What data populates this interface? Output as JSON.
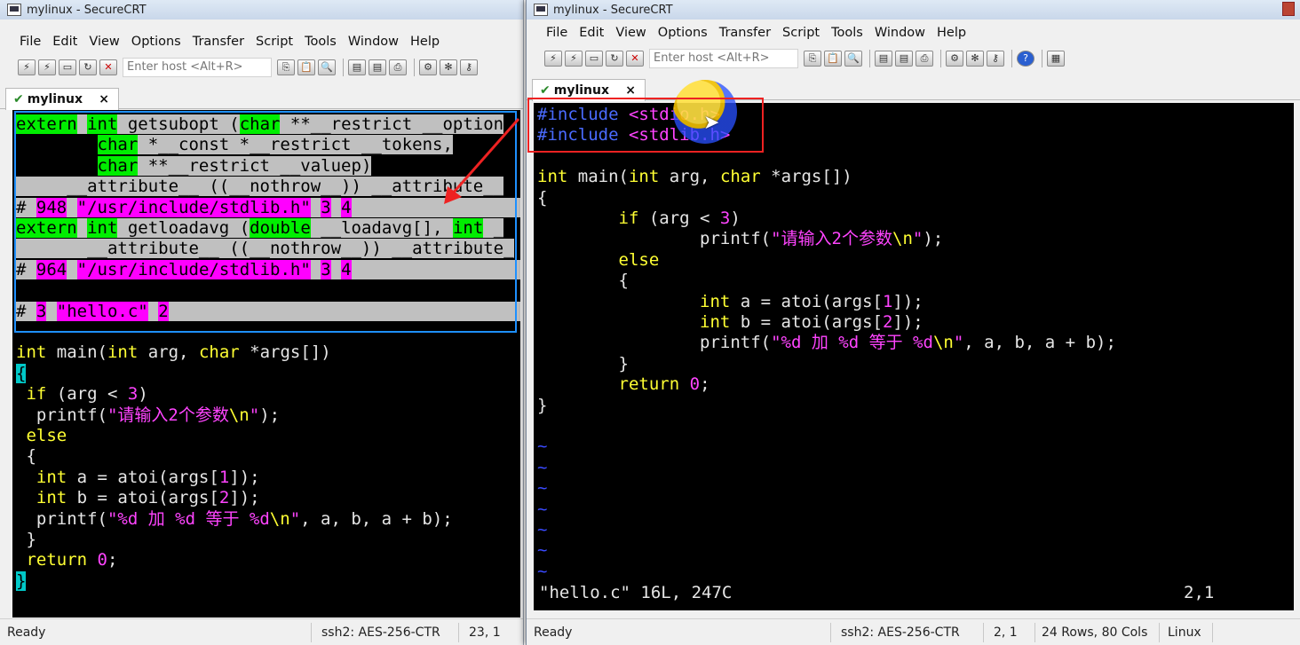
{
  "left": {
    "title": "mylinux - SecureCRT",
    "menu": [
      "File",
      "Edit",
      "View",
      "Options",
      "Transfer",
      "Script",
      "Tools",
      "Window",
      "Help"
    ],
    "host_placeholder": "Enter host <Alt+R>",
    "tab": {
      "label": "mylinux",
      "close": "×"
    },
    "lines": [
      [
        [
          "extern",
          "g"
        ],
        [
          " ",
          "grey"
        ],
        [
          "int",
          "g"
        ],
        [
          " getsubopt (",
          "grey"
        ],
        [
          "char",
          "g"
        ],
        [
          " **__restrict __option",
          "grey"
        ]
      ],
      [
        [
          "        ",
          "blk"
        ],
        [
          "char",
          "g"
        ],
        [
          " *__const *__restrict __tokens,",
          "grey"
        ]
      ],
      [
        [
          "        ",
          "blk"
        ],
        [
          "char",
          "g"
        ],
        [
          " **__restrict __valuep)",
          "grey"
        ]
      ],
      [
        [
          "     __attribute__ ((__nothrow__)) __attribute__",
          "grey"
        ]
      ],
      [
        [
          "# ",
          "grey"
        ],
        [
          "948",
          "m"
        ],
        [
          " ",
          "grey"
        ],
        [
          "\"/usr/include/stdlib.h\"",
          "m"
        ],
        [
          " ",
          "grey"
        ],
        [
          "3",
          "m"
        ],
        [
          " ",
          "grey"
        ],
        [
          "4",
          "m"
        ],
        [
          "                 ",
          "grey"
        ]
      ],
      [
        [
          "extern",
          "g"
        ],
        [
          " ",
          "grey"
        ],
        [
          "int",
          "g"
        ],
        [
          " getloadavg (",
          "grey"
        ],
        [
          "double",
          "g"
        ],
        [
          " __loadavg[], ",
          "grey"
        ],
        [
          "int",
          "g"
        ],
        [
          " _",
          "grey"
        ]
      ],
      [
        [
          "       __attribute__ ((__nothrow__)) __attribute_",
          "grey"
        ]
      ],
      [
        [
          "# ",
          "grey"
        ],
        [
          "964",
          "m"
        ],
        [
          " ",
          "grey"
        ],
        [
          "\"/usr/include/stdlib.h\"",
          "m"
        ],
        [
          " ",
          "grey"
        ],
        [
          "3",
          "m"
        ],
        [
          " ",
          "grey"
        ],
        [
          "4",
          "m"
        ],
        [
          "                 ",
          "grey"
        ]
      ],
      [
        [
          "",
          "w"
        ]
      ],
      [
        [
          "# ",
          "grey"
        ],
        [
          "3",
          "m"
        ],
        [
          " ",
          "grey"
        ],
        [
          "\"hello.c\"",
          "m"
        ],
        [
          " ",
          "grey"
        ],
        [
          "2",
          "m"
        ],
        [
          "                                    ",
          "grey"
        ]
      ],
      [
        [
          "",
          "w"
        ]
      ],
      [
        [
          "int",
          "y"
        ],
        [
          " main(",
          "w"
        ],
        [
          "int",
          "y"
        ],
        [
          " arg, ",
          "w"
        ],
        [
          "char",
          "y"
        ],
        [
          " *args[])",
          "w"
        ]
      ],
      [
        [
          "{",
          "cy"
        ]
      ],
      [
        [
          " ",
          "w"
        ],
        [
          "if",
          "y"
        ],
        [
          " (arg < ",
          "w"
        ],
        [
          "3",
          "mg"
        ],
        [
          ")",
          "w"
        ]
      ],
      [
        [
          "  printf(",
          "w"
        ],
        [
          "\"请输入2个参数",
          "mg"
        ],
        [
          "\\n",
          "y"
        ],
        [
          "\"",
          "mg"
        ],
        [
          ");",
          "w"
        ]
      ],
      [
        [
          " ",
          "w"
        ],
        [
          "else",
          "y"
        ]
      ],
      [
        [
          " {",
          "w"
        ]
      ],
      [
        [
          "  ",
          "w"
        ],
        [
          "int",
          "y"
        ],
        [
          " a = atoi(args[",
          "w"
        ],
        [
          "1",
          "mg"
        ],
        [
          "]);",
          "w"
        ]
      ],
      [
        [
          "  ",
          "w"
        ],
        [
          "int",
          "y"
        ],
        [
          " b = atoi(args[",
          "w"
        ],
        [
          "2",
          "mg"
        ],
        [
          "]);",
          "w"
        ]
      ],
      [
        [
          "  printf(",
          "w"
        ],
        [
          "\"%d 加 %d 等于 %d",
          "mg"
        ],
        [
          "\\n",
          "y"
        ],
        [
          "\"",
          "mg"
        ],
        [
          ", a, b, a + b);",
          "w"
        ]
      ],
      [
        [
          " }",
          "w"
        ]
      ],
      [
        [
          " ",
          "w"
        ],
        [
          "return",
          "y"
        ],
        [
          " ",
          "w"
        ],
        [
          "0",
          "mg"
        ],
        [
          ";",
          "w"
        ]
      ],
      [
        [
          "}",
          "cy"
        ]
      ]
    ],
    "status": {
      "ready": "Ready",
      "ssh": "ssh2: AES-256-CTR",
      "pos": "23,  1"
    }
  },
  "right": {
    "title": "mylinux - SecureCRT",
    "menu": [
      "File",
      "Edit",
      "View",
      "Options",
      "Transfer",
      "Script",
      "Tools",
      "Window",
      "Help"
    ],
    "host_placeholder": "Enter host <Alt+R>",
    "tab": {
      "label": "mylinux",
      "close": "×"
    },
    "lines": [
      [
        [
          "#include",
          "bl"
        ],
        [
          " ",
          "w"
        ],
        [
          "<stdio.h>",
          "mg"
        ]
      ],
      [
        [
          "#include",
          "bl"
        ],
        [
          " ",
          "w"
        ],
        [
          "<stdlib.h>",
          "mg"
        ]
      ],
      [
        [
          "",
          "w"
        ]
      ],
      [
        [
          "int",
          "y"
        ],
        [
          " main(",
          "w"
        ],
        [
          "int",
          "y"
        ],
        [
          " arg, ",
          "w"
        ],
        [
          "char",
          "y"
        ],
        [
          " *args[])",
          "w"
        ]
      ],
      [
        [
          "{",
          "w"
        ]
      ],
      [
        [
          "        ",
          "w"
        ],
        [
          "if",
          "y"
        ],
        [
          " (arg < ",
          "w"
        ],
        [
          "3",
          "mg"
        ],
        [
          ")",
          "w"
        ]
      ],
      [
        [
          "                printf(",
          "w"
        ],
        [
          "\"请输入2个参数",
          "mg"
        ],
        [
          "\\n",
          "y"
        ],
        [
          "\"",
          "mg"
        ],
        [
          ");",
          "w"
        ]
      ],
      [
        [
          "        ",
          "w"
        ],
        [
          "else",
          "y"
        ]
      ],
      [
        [
          "        {",
          "w"
        ]
      ],
      [
        [
          "                ",
          "w"
        ],
        [
          "int",
          "y"
        ],
        [
          " a = atoi(args[",
          "w"
        ],
        [
          "1",
          "mg"
        ],
        [
          "]);",
          "w"
        ]
      ],
      [
        [
          "                ",
          "w"
        ],
        [
          "int",
          "y"
        ],
        [
          " b = atoi(args[",
          "w"
        ],
        [
          "2",
          "mg"
        ],
        [
          "]);",
          "w"
        ]
      ],
      [
        [
          "                printf(",
          "w"
        ],
        [
          "\"%d 加 %d 等于 %d",
          "mg"
        ],
        [
          "\\n",
          "y"
        ],
        [
          "\"",
          "mg"
        ],
        [
          ", a, b, a + b);",
          "w"
        ]
      ],
      [
        [
          "        }",
          "w"
        ]
      ],
      [
        [
          "        ",
          "w"
        ],
        [
          "return",
          "y"
        ],
        [
          " ",
          "w"
        ],
        [
          "0",
          "mg"
        ],
        [
          ";",
          "w"
        ]
      ],
      [
        [
          "}",
          "w"
        ]
      ],
      [
        [
          "",
          "w"
        ]
      ],
      [
        [
          "~",
          "tilde"
        ]
      ],
      [
        [
          "~",
          "tilde"
        ]
      ],
      [
        [
          "~",
          "tilde"
        ]
      ],
      [
        [
          "~",
          "tilde"
        ]
      ],
      [
        [
          "~",
          "tilde"
        ]
      ],
      [
        [
          "~",
          "tilde"
        ]
      ],
      [
        [
          "~",
          "tilde"
        ]
      ]
    ],
    "vim_status": {
      "file": "\"hello.c\" 16L, 247C",
      "pos": "2,1"
    },
    "status": {
      "ready": "Ready",
      "ssh": "ssh2: AES-256-CTR",
      "pos": "2,  1",
      "size": "24 Rows, 80 Cols",
      "os": "Linux"
    }
  }
}
